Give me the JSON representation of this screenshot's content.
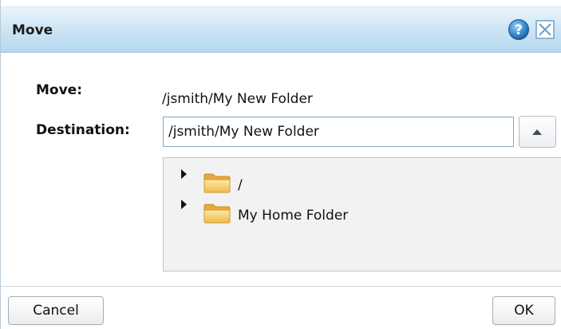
{
  "dialog": {
    "title": "Move",
    "title_bar_colors": [
      "#eaf5fc",
      "#b5d8ef"
    ]
  },
  "icons": {
    "help": "help-icon",
    "close": "close-icon",
    "folder": "folder-icon",
    "expander": "triangle-right-icon",
    "collapse": "triangle-up-icon"
  },
  "form": {
    "move_label": "Move:",
    "move_value": "/jsmith/My New Folder",
    "destination_label": "Destination:",
    "destination_value": "/jsmith/My New Folder"
  },
  "tree": {
    "items": [
      {
        "label": "/"
      },
      {
        "label": "My Home Folder"
      }
    ]
  },
  "footer": {
    "cancel_label": "Cancel",
    "ok_label": "OK"
  }
}
